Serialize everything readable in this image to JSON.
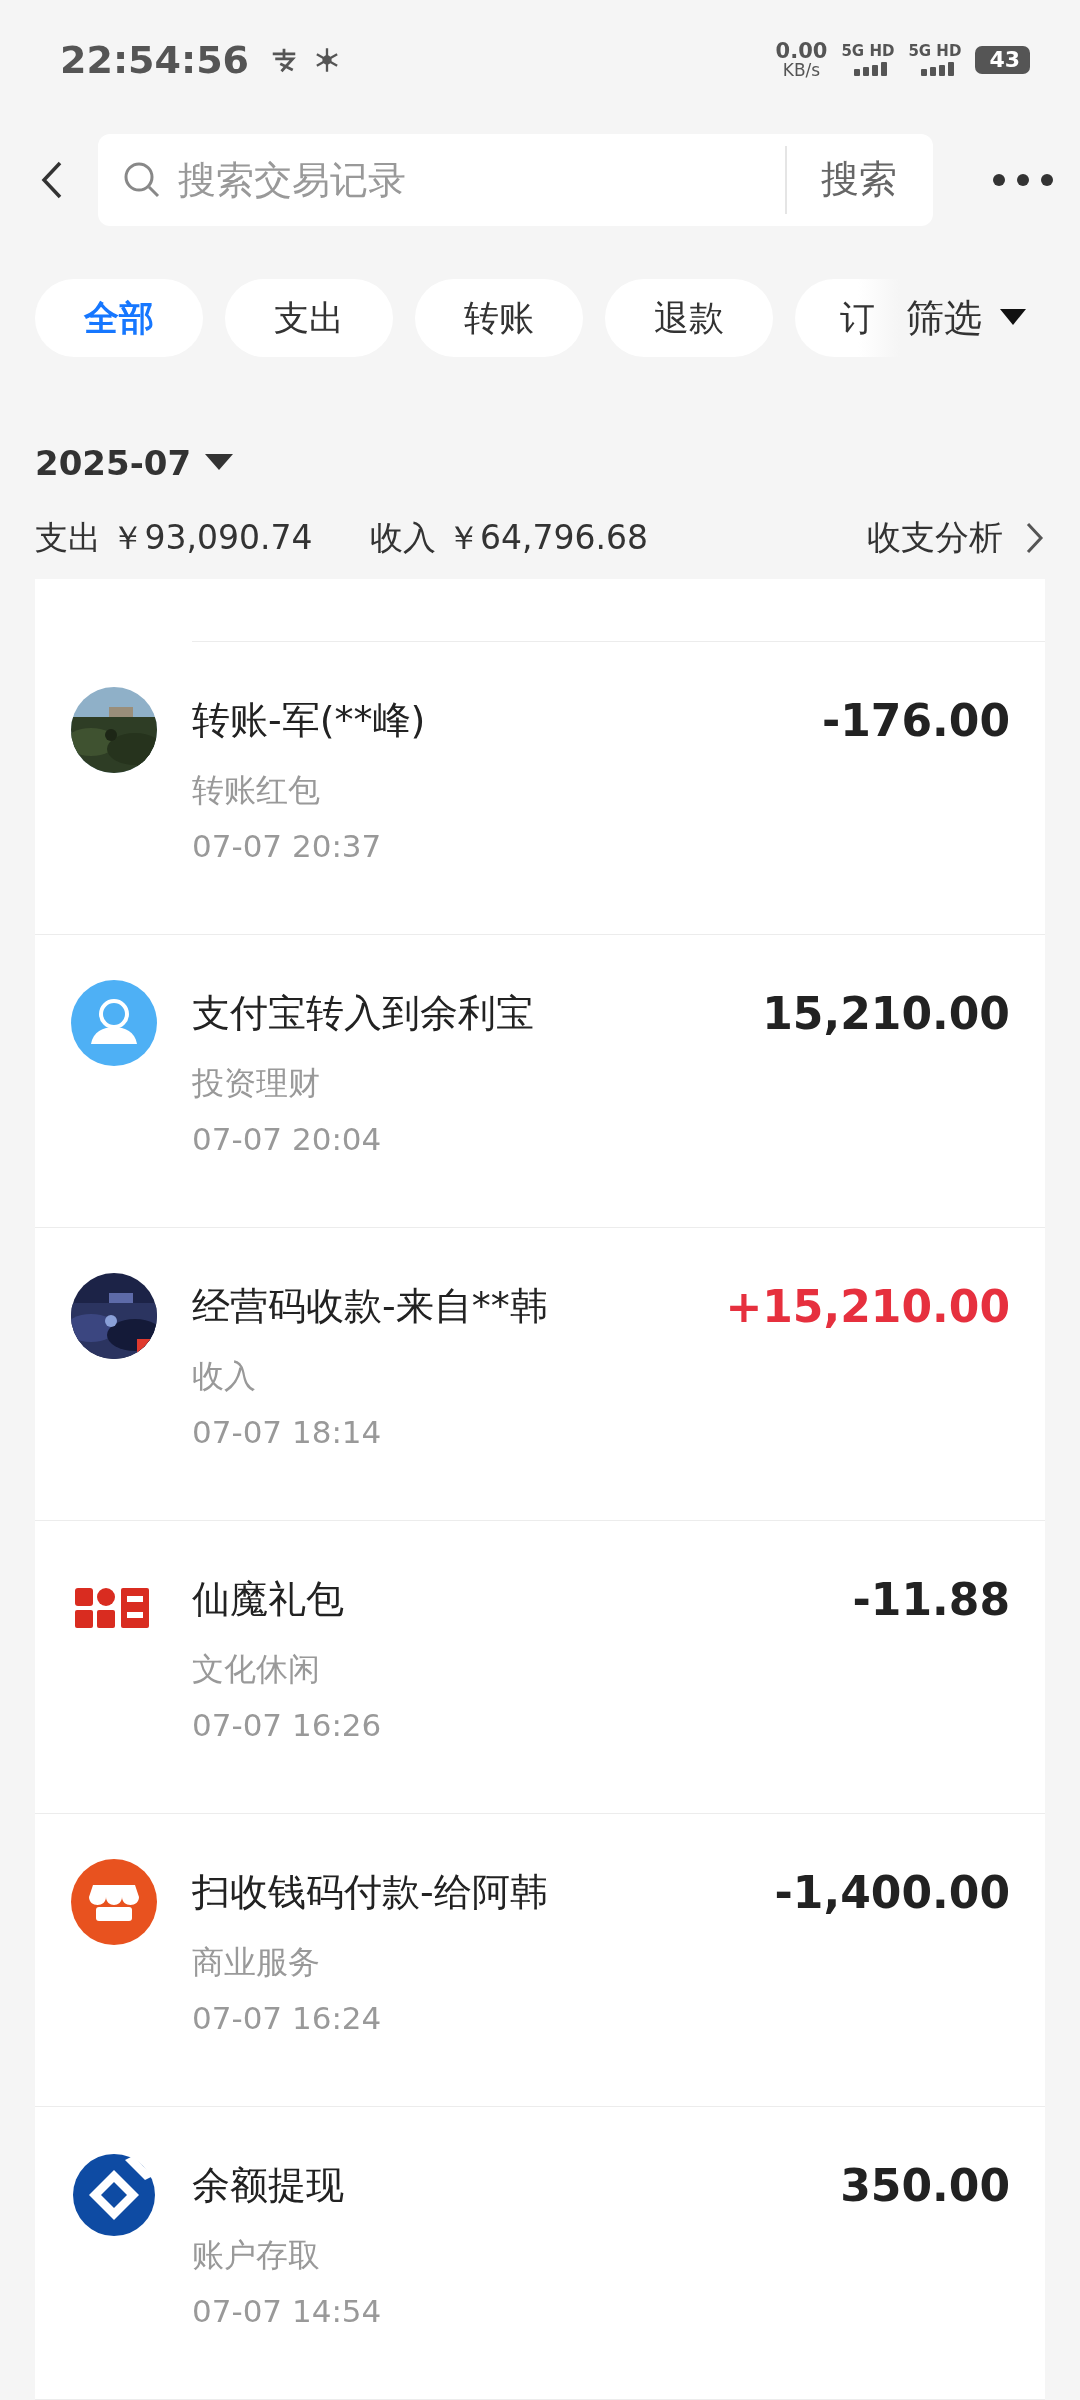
{
  "status_bar": {
    "time": "22:54:56",
    "net_speed": "0.00",
    "net_unit": "KB/s",
    "sim1": "5G HD",
    "sim2": "5G HD",
    "battery": "43"
  },
  "search": {
    "placeholder": "搜索交易记录",
    "button": "搜索"
  },
  "filters": [
    {
      "label": "全部",
      "selected": true
    },
    {
      "label": "支出",
      "selected": false
    },
    {
      "label": "转账",
      "selected": false
    },
    {
      "label": "退款",
      "selected": false
    },
    {
      "label": "订",
      "selected": false
    }
  ],
  "filter_button": "筛选",
  "month": {
    "label": "2025-07",
    "expense": "支出 ￥93,090.74",
    "income": "收入 ￥64,796.68",
    "analysis": "收支分析"
  },
  "transactions": [
    {
      "kind": "picture",
      "title": "转账-军(**峰)",
      "category": "转账红包",
      "time": "07-07 20:37",
      "amount": "-176.00",
      "credit": false
    },
    {
      "kind": "person",
      "title": "支付宝转入到余利宝",
      "category": "投资理财",
      "time": "07-07 20:04",
      "amount": "15,210.00",
      "credit": false
    },
    {
      "kind": "picture",
      "title": "经营码收款-来自**韩",
      "category": "收入",
      "time": "07-07 18:14",
      "amount": "+15,210.00",
      "credit": true
    },
    {
      "kind": "logo",
      "title": "仙魔礼包",
      "category": "文化休闲",
      "time": "07-07 16:26",
      "amount": "-11.88",
      "credit": false
    },
    {
      "kind": "shop",
      "title": "扫收钱码付款-给阿韩",
      "category": "商业服务",
      "time": "07-07 16:24",
      "amount": "-1,400.00",
      "credit": false
    },
    {
      "kind": "bank",
      "title": "余额提现",
      "category": "账户存取",
      "time": "07-07 14:54",
      "amount": "350.00",
      "credit": false
    }
  ]
}
